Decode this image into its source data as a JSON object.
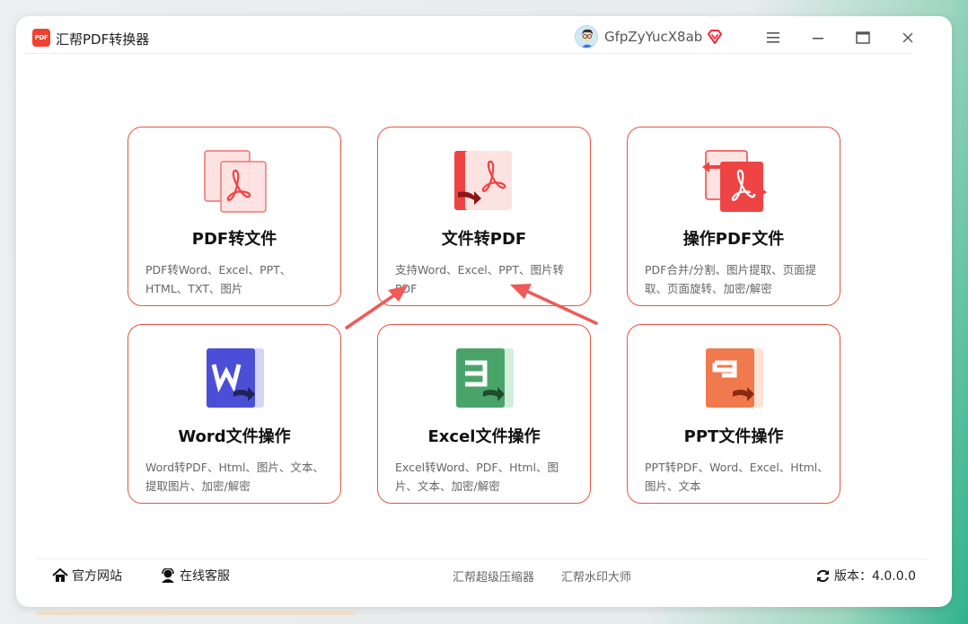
{
  "app": {
    "logo_text": "PDF",
    "title": "汇帮PDF转换器",
    "username": "GfpZyYucX8ab"
  },
  "cards": [
    {
      "title": "PDF转文件",
      "desc": "PDF转Word、Excel、PPT、HTML、TXT、图片",
      "icon": "pdf-convert-icon",
      "color": "#ef4444"
    },
    {
      "title": "文件转PDF",
      "desc": "支持Word、Excel、PPT、图片转PDF",
      "icon": "file-to-pdf-icon",
      "color": "#ef4444"
    },
    {
      "title": "操作PDF文件",
      "desc": "PDF合并/分割、图片提取、页面提取、页面旋转、加密/解密",
      "icon": "pdf-operate-icon",
      "color": "#ef4444"
    },
    {
      "title": "Word文件操作",
      "desc": "Word转PDF、Html、图片、文本、提取图片、加密/解密",
      "icon": "word-icon",
      "color": "#4b4fd6"
    },
    {
      "title": "Excel文件操作",
      "desc": "Excel转Word、PDF、Html、图片、文本、加密/解密",
      "icon": "excel-icon",
      "color": "#4aa46a"
    },
    {
      "title": "PPT文件操作",
      "desc": "PPT转PDF、Word、Excel、Html、图片、文本",
      "icon": "ppt-icon",
      "color": "#f07a4d"
    }
  ],
  "footer": {
    "website": "官方网站",
    "service": "在线客服",
    "compressor": "汇帮超级压缩器",
    "watermark": "汇帮水印大师",
    "version": "版本：4.0.0.0"
  }
}
